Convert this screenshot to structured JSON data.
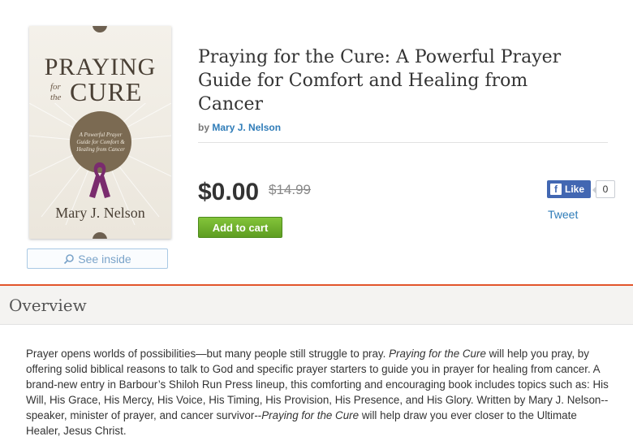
{
  "book": {
    "cover": {
      "title_top": "PRAYING",
      "title_for": "for",
      "title_the": "the",
      "title_bottom": "CURE",
      "medallion_text": "A Powerful Prayer Guide for Comfort & Healing from Cancer",
      "author": "Mary J. Nelson",
      "ribbon_color": "#7a2b6e"
    },
    "title": "Praying for the Cure: A Powerful Prayer Guide for Comfort and Healing from Cancer",
    "by_label": "by",
    "author": "Mary J. Nelson",
    "price": "$0.00",
    "old_price": "$14.99",
    "add_to_cart": "Add to cart",
    "see_inside": "See inside",
    "see_inside_icon": "magnifier-icon"
  },
  "social": {
    "like_label": "Like",
    "like_count": "0",
    "tweet_label": "Tweet",
    "facebook_color": "#4267b2"
  },
  "overview": {
    "heading": "Overview",
    "accent_color": "#e2552b",
    "seg1": "Prayer opens worlds of possibilities—but many people still struggle to pray. ",
    "seg2": "Praying for the Cure",
    "seg3": " will help you pray, by offering solid biblical reasons to talk to God and specific prayer starters to guide you in prayer for healing from cancer. A brand-new entry in Barbour’s Shiloh Run Press lineup, this comforting and encouraging book includes topics such as: His Will, His Grace, His Mercy, His Voice, His Timing, His Provision, His Presence, and His Glory. Written by Mary J. Nelson--speaker, minister of prayer, and cancer survivor--",
    "seg4": "Praying for the Cure",
    "seg5": " will help draw you ever closer to the Ultimate Healer, Jesus Christ."
  }
}
